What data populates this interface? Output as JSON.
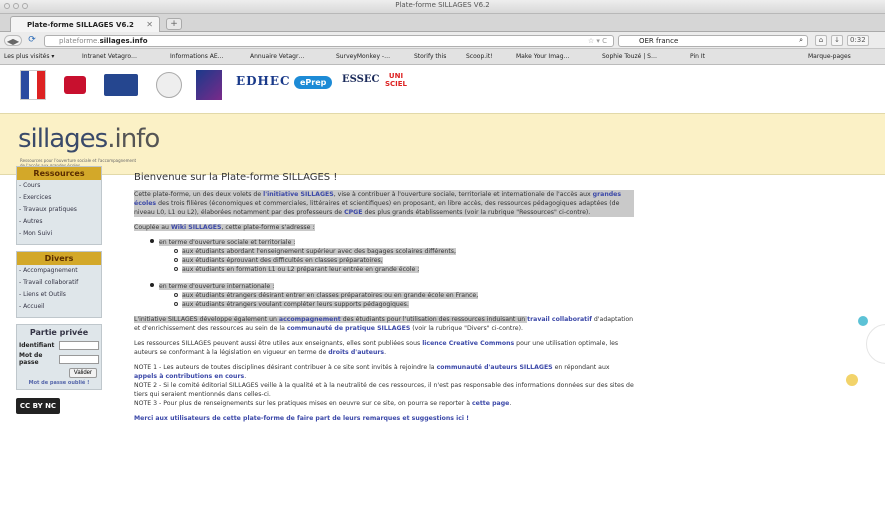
{
  "browser": {
    "window_title": "Plate-forme SILLAGES V6.2",
    "tab_title": "Plate-forme SILLAGES V6.2",
    "url_prefix": "plateforme.",
    "url_domain": "sillages.info",
    "search_engine": "OER france",
    "clock": "0:32",
    "bookmarks": [
      "Les plus visités ▾",
      "Intranet Vetagro…",
      "Informations AE…",
      "Annuaire Vetagr…",
      "SurveyMonkey -…",
      "Storify this",
      "Scoop.it!",
      "Make Your Imag…",
      "Sophie Touzé | S…",
      "Pin It",
      "Marque-pages"
    ]
  },
  "logos": {
    "edhec": "EDHEC",
    "essec": "ESSEC",
    "eprep": "ePrep",
    "unisciel": "UNI SCIEL"
  },
  "banner": {
    "brand_main": "sillages",
    "brand_suffix": ".info",
    "tagline": "Ressources pour l'ouverture sociale et l'accompagnement de l'accès aux grandes écoles"
  },
  "sidebar": {
    "ressources": {
      "title": "Ressources",
      "items": [
        "- Cours",
        "- Exercices",
        "- Travaux pratiques",
        "- Autres",
        "- Mon Suivi"
      ]
    },
    "divers": {
      "title": "Divers",
      "items": [
        "- Accompagnement",
        "- Travail collaboratif",
        "- Liens et Outils",
        "- Accueil"
      ]
    },
    "login": {
      "title": "Partie privée",
      "id_label": "Identifiant",
      "pwd_label": "Mot de passe",
      "submit": "Valider",
      "forgot": "Mot de passe oublié !"
    },
    "license": "CC BY NC SA"
  },
  "main": {
    "title": "Bienvenue sur la Plate-forme SILLAGES !",
    "intro_a": "Cette plate-forme, un des deux volets de ",
    "intro_link1": "l'initiative SILLAGES",
    "intro_b": ", vise à contribuer à l'ouverture sociale, territoriale et internationale de l'accès aux ",
    "intro_link2": "grandes écoles",
    "intro_c": " des trois filières (économiques et commerciales, littéraires et scientifiques) en proposant, en libre accès, des ressources pédagogiques adaptées (de niveau L0, L1 ou L2), élaborées notamment par des professeurs de ",
    "intro_link3": "CPGE",
    "intro_d": " des plus grands établissements (voir la rubrique \"Ressources\" ci-contre).",
    "coupled_a": "Couplée au ",
    "coupled_link": "Wiki SILLAGES",
    "coupled_b": ", cette plate-forme s'adresse :",
    "group1_title": "en terme d'ouverture sociale et territoriale :",
    "group1_items": [
      "aux étudiants abordant l'enseignement supérieur avec des bagages scolaires différents,",
      "aux étudiants éprouvant des difficultés en classes préparatoires,",
      "aux étudiants en formation L1 ou L2 préparant leur entrée en grande école ;"
    ],
    "group2_title": "en terme d'ouverture internationale :",
    "group2_items": [
      "aux étudiants étrangers désirant entrer en classes préparatoires ou en grande école en France,",
      "aux étudiants étrangers voulant compléter leurs supports pédagogiques."
    ],
    "p3_a": "L'initiative SILLAGES développe également un ",
    "p3_link1": "accompagnement",
    "p3_b": " des étudiants pour l'utilisation des ressources induisant un ",
    "p3_link2": "travail collaboratif",
    "p3_c": " d'adaptation et d'enrichissement des ressources au sein de la ",
    "p3_link3": "communauté de pratique SILLAGES",
    "p3_d": " (voir la rubrique \"Divers\" ci-contre).",
    "p4_a": "Les ressources SILLAGES peuvent aussi être utiles aux enseignants, elles sont publiées sous ",
    "p4_link1": "licence Creative Commons",
    "p4_b": " pour une utilisation optimale, les auteurs se conformant à la législation en vigueur en terme de ",
    "p4_link2": "droits d'auteurs",
    "p4_c": ".",
    "note1_a": "NOTE 1 - Les auteurs de toutes disciplines désirant contribuer à ce site sont invités à rejoindre la ",
    "note1_link1": "communauté d'auteurs SILLAGES",
    "note1_b": " en répondant aux ",
    "note1_link2": "appels à contributions en cours",
    "note1_c": ".",
    "note2": "NOTE 2 - Si le comité éditorial SILLAGES veille à la qualité et à la neutralité de ces ressources, il n'est pas responsable des informations données sur des sites de tiers qui seraient mentionnés dans celles-ci.",
    "note3_a": "NOTE 3 - Pour plus de renseignements sur les pratiques mises en oeuvre sur ce site, on pourra se reporter à ",
    "note3_link": "cette page",
    "note3_b": ".",
    "thanks": "Merci aux utilisateurs de cette plate-forme de faire part de leurs remarques et suggestions ici !"
  },
  "colors": {
    "accent_gold": "#d3a829",
    "link_blue": "#3b48a8",
    "banner_bg": "#fbf1c6",
    "highlight": "#c9c9c9"
  }
}
